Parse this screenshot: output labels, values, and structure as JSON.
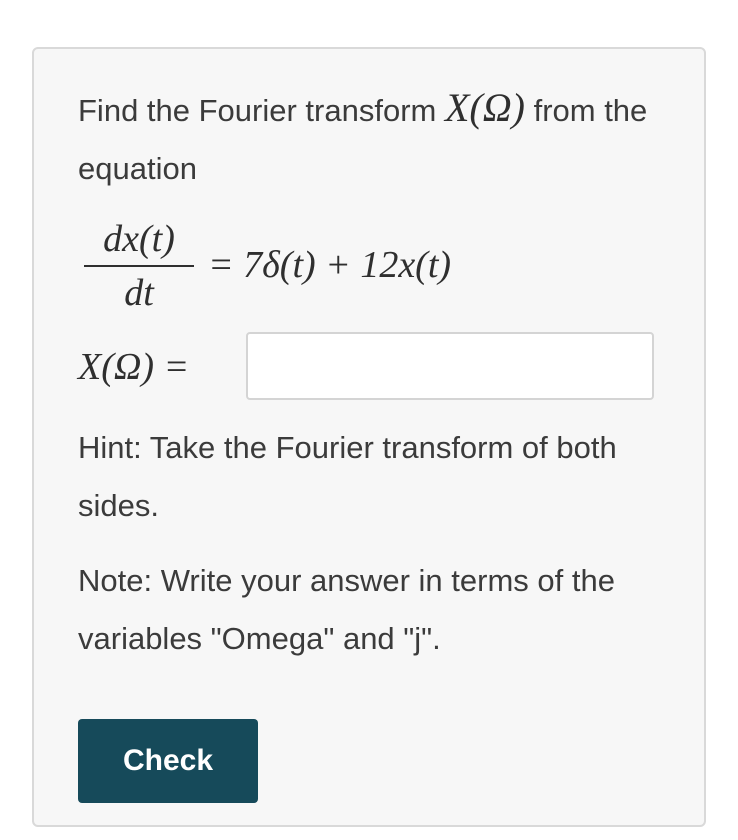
{
  "question": {
    "prompt_before": "Find the Fourier transform ",
    "prompt_symbol": "X(Ω)",
    "prompt_after": " from the equation"
  },
  "equation": {
    "numerator": "dx(t)",
    "denominator": "dt",
    "rhs": "= 7δ(t) + 12x(t)"
  },
  "answer": {
    "label": "X(Ω) =",
    "value": "",
    "placeholder": ""
  },
  "hint": "Hint: Take the Fourier transform of both sides.",
  "note": "Note: Write your answer in terms of the variables \"Omega\" and \"j\".",
  "check_button": {
    "label": "Check"
  },
  "colors": {
    "button_background": "#164a5a",
    "card_background": "#f7f7f7",
    "card_border": "#d9d9d9"
  }
}
